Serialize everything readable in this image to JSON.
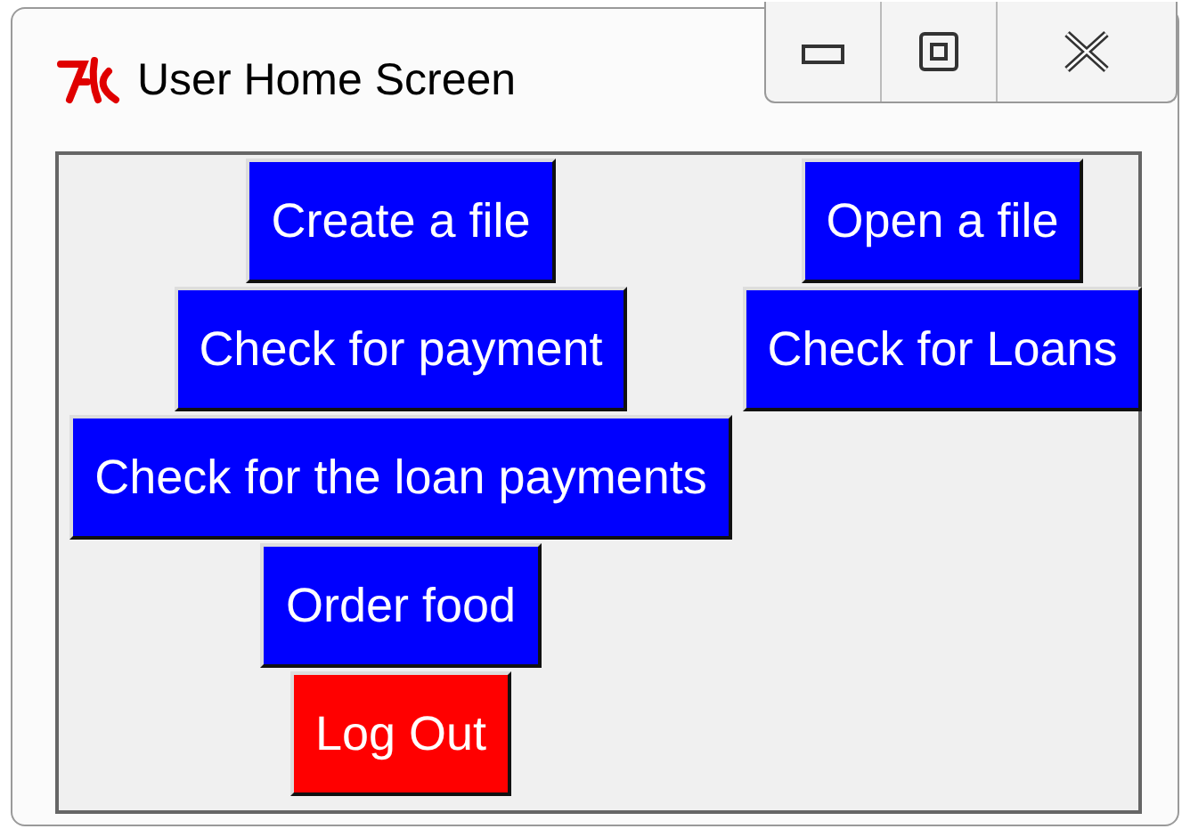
{
  "window": {
    "title": "User Home Screen"
  },
  "rows": [
    {
      "buttons": [
        {
          "label": "Create a file",
          "color": "#0000ff"
        },
        {
          "label": "Open a file",
          "color": "#0000ff"
        }
      ]
    },
    {
      "buttons": [
        {
          "label": "Check for payment",
          "color": "#0000ff"
        },
        {
          "label": "Check for Loans",
          "color": "#0000ff"
        }
      ]
    },
    {
      "buttons": [
        {
          "label": "Check for the loan payments",
          "color": "#0000ff"
        }
      ]
    },
    {
      "buttons": [
        {
          "label": "Order food",
          "color": "#0000ff"
        }
      ]
    },
    {
      "buttons": [
        {
          "label": "Log Out",
          "color": "#ff0000"
        }
      ]
    }
  ]
}
